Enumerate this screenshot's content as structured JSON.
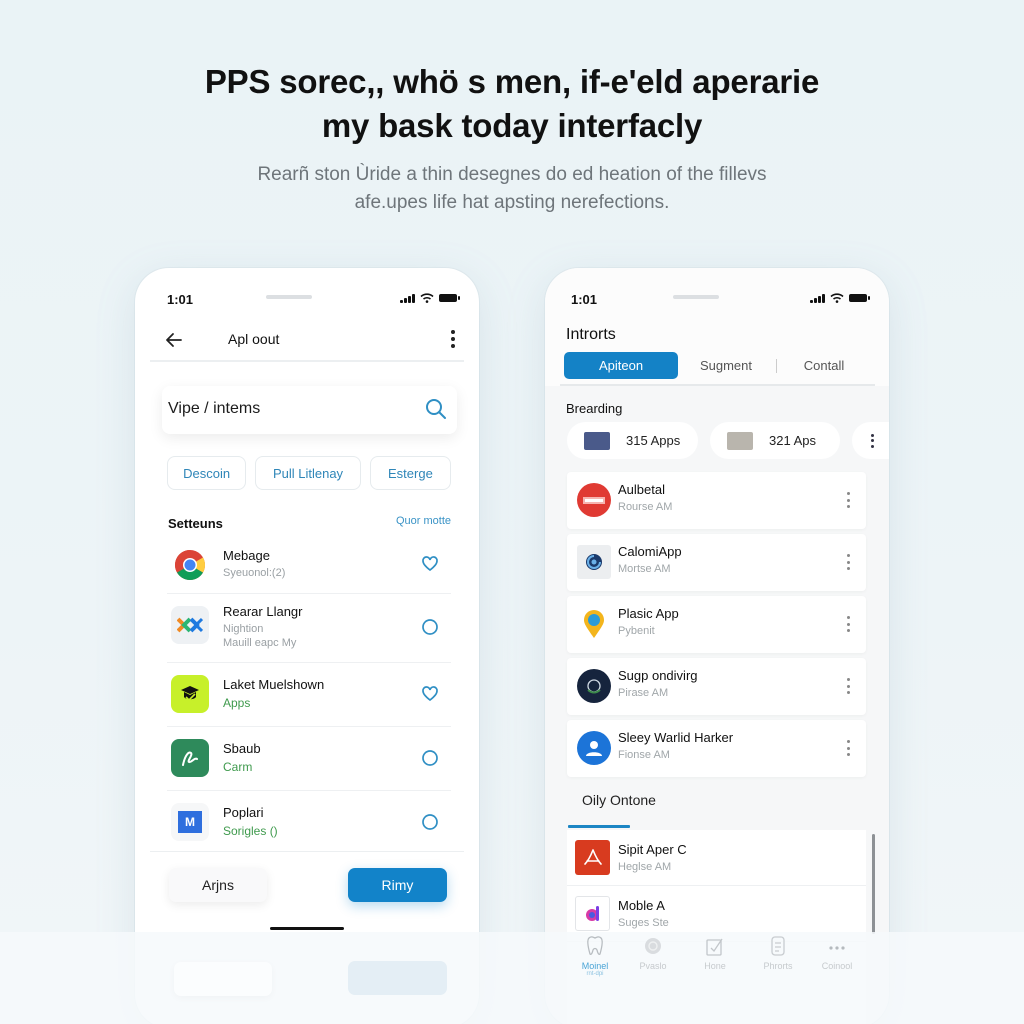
{
  "hero": {
    "headline_line1": "PPS sorec,, whö s men, if-e'eld aperarie",
    "headline_line2": "my bask today interfacly",
    "subline_line1": "Rearñ ston Ùride a thin desegnes do ed heation of the fillevs",
    "subline_line2": "afe.upes life hat apsting nerefections."
  },
  "left_phone": {
    "status": {
      "time": "1:01"
    },
    "appbar": {
      "title": "Apl oout",
      "back_icon": "arrow-left-icon",
      "menu_icon": "kebab-icon"
    },
    "search": {
      "value": "Vipe / intems",
      "icon": "search-icon"
    },
    "chips": [
      "Descoin",
      "Pull Litlenay",
      "Esterge"
    ],
    "section": {
      "title": "Setteuns",
      "link": "Quor motte"
    },
    "items": [
      {
        "title": "Mebage",
        "subtitle": "Syeuonol:(2)",
        "icon": "chrome-icon",
        "action": "heart-icon"
      },
      {
        "title": "Rearar Llangr",
        "subtitle": "Nightion",
        "subtitle2": "Mauill eapc My",
        "icon": "xk-icon",
        "action": "circle-icon"
      },
      {
        "title": "Laket Muelshown",
        "subtitle": "Apps",
        "icon": "graduation-icon",
        "action": "heart-icon"
      },
      {
        "title": "Sbaub",
        "subtitle": "Carm",
        "icon": "scribble-icon",
        "action": "circle-icon"
      },
      {
        "title": "Poplari",
        "subtitle": "Sorigles ()",
        "icon": "m-logo-icon",
        "action": "circle-icon"
      }
    ],
    "buttons": {
      "secondary": "Arjns",
      "primary": "Rimy"
    }
  },
  "right_phone": {
    "status": {
      "time": "1:01"
    },
    "title": "Introrts",
    "segments": [
      {
        "label": "Apiteon",
        "active": true
      },
      {
        "label": "Sugment",
        "active": false
      },
      {
        "label": "Contall",
        "active": false
      }
    ],
    "section": "Brearding",
    "pills": [
      {
        "label": "315 Apps",
        "icon": "image-icon"
      },
      {
        "label": "321 Aps",
        "icon": "photo-icon"
      }
    ],
    "cards": [
      {
        "title": "Aulbetal",
        "subtitle": "Rourse AM",
        "icon": "red-badge-icon"
      },
      {
        "title": "CalomiApp",
        "subtitle": "Mortse AM",
        "icon": "swirl-icon"
      },
      {
        "title": "Plasic App",
        "subtitle": "Pybenit",
        "icon": "map-pin-icon"
      },
      {
        "title": "Sugp ondivirg",
        "subtitle": "Pirase AM",
        "icon": "globe-icon"
      },
      {
        "title": "Sleey Warlid Harker",
        "subtitle": "Fionse AM",
        "icon": "person-icon"
      }
    ],
    "tab_title": "Oily Ontone",
    "list": [
      {
        "title": "Sipit Aper C",
        "subtitle": "Heglse AM",
        "icon": "acrobat-icon"
      },
      {
        "title": "Moble A",
        "subtitle": "Suges Ste",
        "icon": "d-logo-icon"
      }
    ],
    "tabbar": [
      {
        "label": "Moinel",
        "sublabel": "rnt-dpi",
        "icon": "tooth-icon",
        "active": true
      },
      {
        "label": "Pvaslo",
        "icon": "disc-icon",
        "active": false
      },
      {
        "label": "Hone",
        "icon": "edit-icon",
        "active": false
      },
      {
        "label": "Phrorts",
        "icon": "document-icon",
        "active": false
      },
      {
        "label": "Coinool",
        "icon": "more-icon",
        "active": false
      }
    ]
  },
  "colors": {
    "accent": "#1283c9",
    "link": "#2f86b8",
    "green_text": "#3f9a4d",
    "background": "#eaf3f6"
  }
}
